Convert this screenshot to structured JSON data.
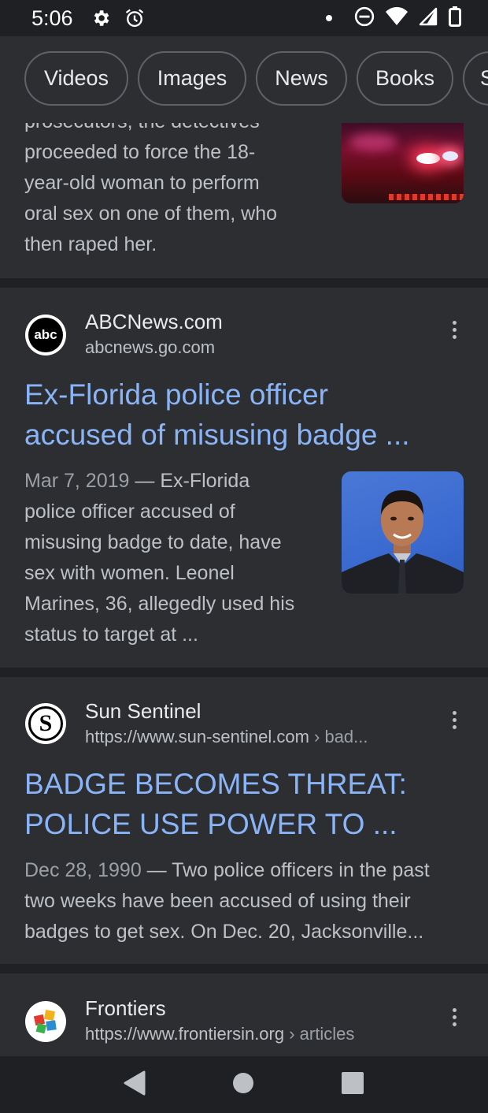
{
  "status_bar": {
    "time": "5:06",
    "icons": [
      "gear-icon",
      "alarm-icon",
      "dot-icon",
      "dnd-icon",
      "wifi-icon",
      "signal-icon",
      "battery-icon"
    ]
  },
  "chips": [
    "Videos",
    "Images",
    "News",
    "Books",
    "S"
  ],
  "result0": {
    "snippet_lines": [
      "prosecutors, the detectives",
      "proceeded to force the 18-",
      "year-old woman to perform",
      "oral sex on one of them, who",
      "then raped her."
    ]
  },
  "result1": {
    "site_name": "ABCNews.com",
    "url": "abcnews.go.com",
    "favicon_text": "abc",
    "title_lines": [
      "Ex-Florida police officer",
      "accused of misusing badge ..."
    ],
    "date": "Mar 7, 2019",
    "snippet_lines": [
      "Ex-Florida",
      "police officer accused of",
      "misusing badge to date, have",
      "sex with women. Leonel",
      "Marines, 36, allegedly used his",
      "status to target at ..."
    ]
  },
  "result2": {
    "site_name": "Sun Sentinel",
    "url": "https://www.sun-sentinel.com",
    "url_path": " › bad...",
    "favicon_text": "S",
    "title_lines": [
      "BADGE BECOMES THREAT:",
      "POLICE USE POWER TO ..."
    ],
    "date": "Dec 28, 1990",
    "snippet_lines": [
      "Two police officers in the past",
      "two weeks have been accused of using their",
      "badges to get sex. On Dec. 20, Jacksonville..."
    ]
  },
  "result3": {
    "site_name": "Frontiers",
    "url": "https://www.frontiersin.org",
    "url_path": " › articles"
  },
  "nav": [
    "back-icon",
    "home-icon",
    "recents-icon"
  ],
  "colors": {
    "background": "#202124",
    "card": "#2d2e31",
    "link": "#8ab4f8",
    "text": "#bdc1c6"
  }
}
